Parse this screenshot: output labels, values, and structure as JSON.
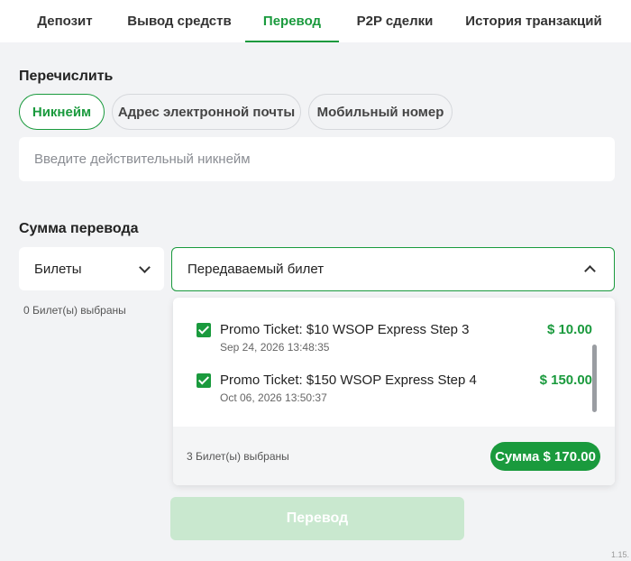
{
  "tabs": {
    "deposit": "Депозит",
    "withdraw": "Вывод средств",
    "transfer": "Перевод",
    "p2p": "P2P сделки",
    "history": "История транзакций",
    "active": "transfer"
  },
  "recipient": {
    "title": "Перечислить",
    "methods": {
      "nickname": "Никнейм",
      "email": "Адрес электронной почты",
      "mobile": "Мобильный номер"
    },
    "active_method": "nickname",
    "input_value": "",
    "input_placeholder": "Введите действительный никнейм"
  },
  "amount": {
    "title": "Сумма перевода",
    "type_selected": "Билеты",
    "left_selected_count": "0 Билет(ы) выбраны",
    "dropdown_label": "Передаваемый билет",
    "tickets": [
      {
        "name": "Promo Ticket: $10 WSOP Express Step 3",
        "date": "Sep 24, 2026 13:48:35",
        "value": "$ 10.00",
        "checked": true
      },
      {
        "name": "Promo Ticket: $150 WSOP Express Step 4",
        "date": "Oct 06, 2026 13:50:37",
        "value": "$ 150.00",
        "checked": true
      }
    ],
    "footer_selected_count": "3 Билет(ы) выбраны",
    "sum_label": "Сумма $ 170.00"
  },
  "submit_label": "Перевод",
  "version": "1.15.",
  "colors": {
    "accent": "#1a9a3d",
    "submit_disabled": "#c9e8cf",
    "background": "#f2f3f5"
  }
}
